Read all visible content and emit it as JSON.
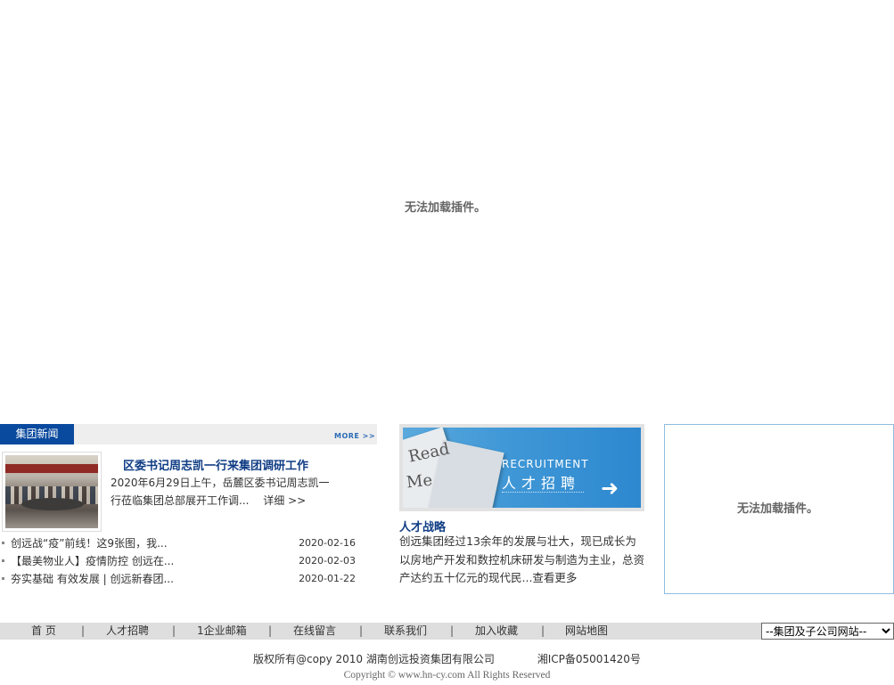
{
  "main_plugin": {
    "message": "无法加载插件。"
  },
  "news": {
    "tab_label": "集团新闻",
    "more_label": "MORE >>",
    "headline": "区委书记周志凯一行来集团调研工作",
    "summary": "2020年6月29日上午，岳麓区委书记周志凯一行莅临集团总部展开工作调...",
    "detail_label": "详细 >>",
    "items": [
      {
        "title": "创远战“疫”前线！这9张图，我...",
        "date": "2020-02-16"
      },
      {
        "title": "【最美物业人】疫情防控 创远在...",
        "date": "2020-02-03"
      },
      {
        "title": "夯实基础 有效发展 | 创远新春团...",
        "date": "2020-01-22"
      }
    ]
  },
  "recruitment": {
    "banner_paper_word1": "Read",
    "banner_paper_word2": "Me",
    "banner_en": "RECRUITMENT",
    "banner_cn": "人才招聘",
    "title": "人才战略",
    "text": "创远集团经过13余年的发展与壮大，现已成长为以房地产开发和数控机床研发与制造为主业，总资产达约五十亿元的现代民...",
    "more_label": "查看更多"
  },
  "side_plugin": {
    "message": "无法加载插件。"
  },
  "footer_nav": {
    "items": [
      "首 页",
      "人才招聘",
      "1企业邮箱",
      "在线留言",
      "联系我们",
      "加入收藏",
      "网站地图"
    ],
    "separator": "|",
    "site_select": "--集团及子公司网站--"
  },
  "copyright": {
    "line1": "版权所有@copy 2010 湖南创远投资集团有限公司",
    "icp": "湘ICP备05001420号",
    "line2": "Copyright © www.hn-cy.com All Rights Reserved"
  },
  "colors": {
    "brand_blue": "#0a4a9e",
    "link_blue": "#0f3c84",
    "box_border": "#8fbde0"
  }
}
